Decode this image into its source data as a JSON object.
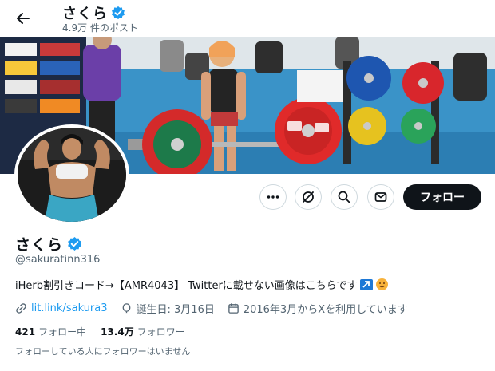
{
  "header": {
    "name": "さくら",
    "post_count": "4.9万 件のポスト"
  },
  "profile": {
    "display_name": "さくら",
    "handle": "@sakuratinn316",
    "bio_text": "iHerb割引きコード→【AMR4043】 Twitterに載せない画像はこちらです",
    "link": "lit.link/sakura3",
    "birthday": "誕生日: 3月16日",
    "joined": "2016年3月からXを利用しています",
    "following_count": "421",
    "following_label": "フォロー中",
    "followers_count": "13.4万",
    "followers_label": "フォロワー",
    "followers_you_know": "フォローしている人にフォロワーはいません"
  },
  "actions": {
    "follow_label": "フォロー"
  },
  "banner": {
    "plate_labels": [
      "25",
      "25",
      "ONI",
      "ONI"
    ]
  },
  "colors": {
    "accent": "#1d9bf0",
    "verified": "#1d9bf0",
    "text_primary": "#0f1419",
    "text_secondary": "#536471"
  },
  "icons": [
    "back-arrow-icon",
    "verified-badge-icon",
    "more-icon",
    "grok-icon",
    "search-icon",
    "message-icon",
    "link-icon",
    "birthday-icon",
    "calendar-icon"
  ]
}
